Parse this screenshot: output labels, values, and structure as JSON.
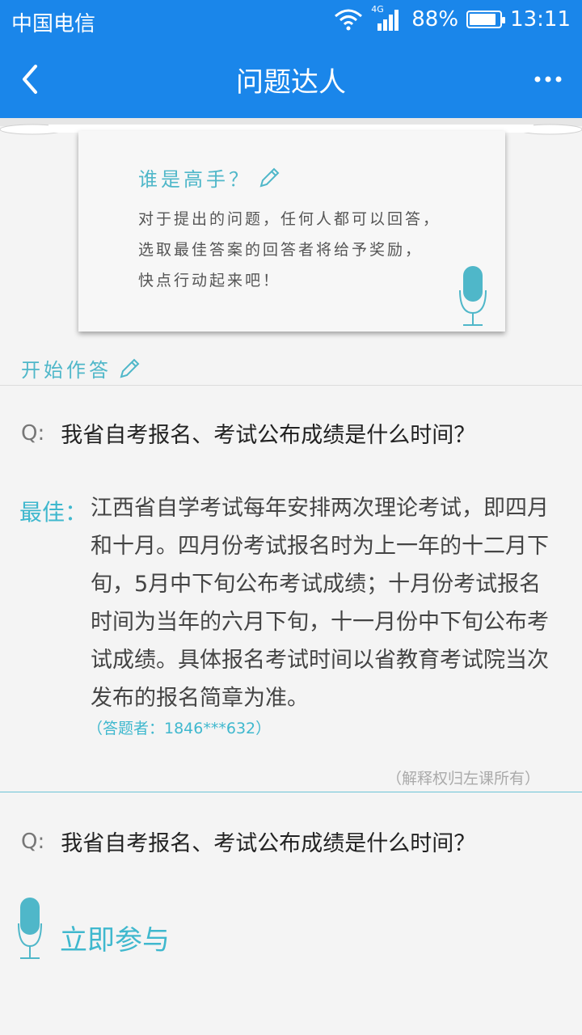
{
  "status_bar": {
    "carrier": "中国电信",
    "network": "4G",
    "battery_percent": "88%",
    "battery_level": 0.88,
    "time": "13:11"
  },
  "nav": {
    "back_icon": "chevron-left-icon",
    "title": "问题达人",
    "more_icon": "more-dots-icon"
  },
  "intro_card": {
    "heading": "谁是高手？",
    "lines": [
      "对于提出的问题，任何人都可以回答，",
      "选取最佳答案的回答者将给予奖励，",
      "快点行动起来吧！"
    ]
  },
  "start_label": "开始作答",
  "questions": [
    {
      "prefix": "Q:",
      "text": "我省自考报名、考试公布成绩是什么时间？",
      "best_label": "最佳：",
      "answer": "江西省自学考试每年安排两次理论考试，即四月和十月。四月份考试报名时为上一年的十二月下旬，5月中下旬公布考试成绩；十月份考试报名时间为当年的六月下旬，十一月份中下旬公布考试成绩。具体报名考试时间以省教育考试院当次发布的报名简章为准。",
      "answerer": "（答题者：1846***632）",
      "copyright": "（解释权归左课所有）"
    },
    {
      "prefix": "Q:",
      "text": "我省自考报名、考试公布成绩是什么时间？"
    }
  ],
  "join_label": "立即参与",
  "colors": {
    "primary": "#1a86ea",
    "accent": "#3fb8ce",
    "background": "#f4f4f4"
  }
}
